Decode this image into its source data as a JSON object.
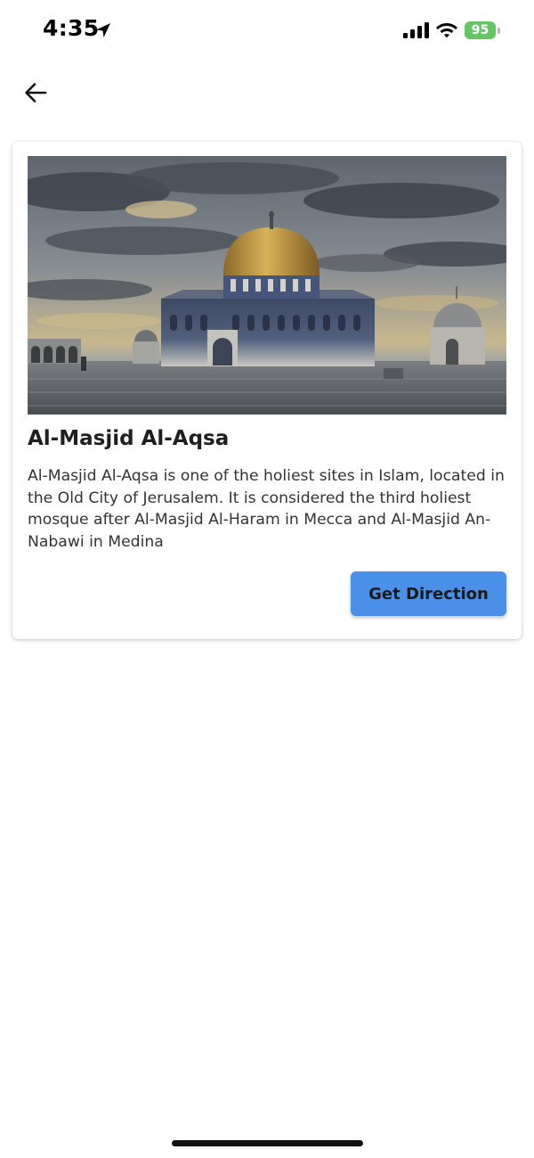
{
  "status_bar": {
    "time": "4:35",
    "battery_level": "95",
    "battery_color": "#65c466",
    "icons": [
      "location-arrow-icon",
      "cellular-signal-icon",
      "wifi-icon",
      "battery-icon"
    ]
  },
  "nav": {
    "back_icon": "arrow-left-icon"
  },
  "card": {
    "image_subject": "Dome of the Rock, Jerusalem",
    "title": "Al-Masjid Al-Aqsa",
    "description": "Al-Masjid Al-Aqsa is one of the holiest sites in Islam, located in the Old City of Jerusalem. It is considered the third holiest mosque after Al-Masjid Al-Haram in Mecca and Al-Masjid An-Nabawi in Medina",
    "button_label": "Get Direction",
    "button_color": "#4a90e8"
  }
}
